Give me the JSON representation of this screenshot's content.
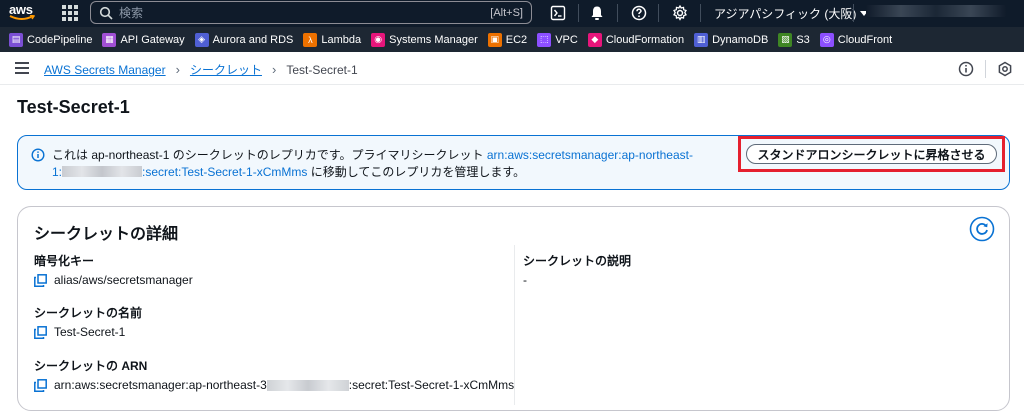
{
  "topnav": {
    "logo_text": "aws",
    "search_placeholder": "検索",
    "search_shortcut": "[Alt+S]",
    "region": "アジアパシフィック (大阪)",
    "account": ""
  },
  "favorites": [
    {
      "label": "CodePipeline",
      "color": "#7b4fd4",
      "icon": "codepipeline-icon"
    },
    {
      "label": "API Gateway",
      "color": "#a14fd4",
      "icon": "api-gateway-icon"
    },
    {
      "label": "Aurora and RDS",
      "color": "#4f5fd4",
      "icon": "rds-icon"
    },
    {
      "label": "Lambda",
      "color": "#ed7100",
      "icon": "lambda-icon"
    },
    {
      "label": "Systems Manager",
      "color": "#e7157b",
      "icon": "systems-manager-icon"
    },
    {
      "label": "EC2",
      "color": "#ed7100",
      "icon": "ec2-icon"
    },
    {
      "label": "VPC",
      "color": "#8c4fff",
      "icon": "vpc-icon"
    },
    {
      "label": "CloudFormation",
      "color": "#e7157b",
      "icon": "cloudformation-icon"
    },
    {
      "label": "DynamoDB",
      "color": "#4f5fd4",
      "icon": "dynamodb-icon"
    },
    {
      "label": "S3",
      "color": "#3f8624",
      "icon": "s3-icon"
    },
    {
      "label": "CloudFront",
      "color": "#8c4fff",
      "icon": "cloudfront-icon"
    }
  ],
  "breadcrumb": {
    "items": [
      "AWS Secrets Manager",
      "シークレット"
    ],
    "current": "Test-Secret-1"
  },
  "page": {
    "title": "Test-Secret-1"
  },
  "banner": {
    "text_before": "これは ap-northeast-1 のシークレットのレプリカです。プライマリシークレット ",
    "arn_part1": "arn:aws:secretsmanager:ap-northeast-",
    "arn_part2a": "1:",
    "arn_part2b": ":secret:Test-Secret-1-xCmMms",
    "text_after": " に移動してこのレプリカを管理します。",
    "button": "スタンドアロンシークレットに昇格させる"
  },
  "details": {
    "title": "シークレットの詳細",
    "encryption_key_label": "暗号化キー",
    "encryption_key_value": "alias/aws/secretsmanager",
    "secret_name_label": "シークレットの名前",
    "secret_name_value": "Test-Secret-1",
    "secret_arn_label": "シークレットの ARN",
    "secret_arn_prefix": "arn:aws:secretsmanager:ap-northeast-3",
    "secret_arn_suffix": ":secret:Test-Secret-1-xCmMms",
    "description_label": "シークレットの説明",
    "description_value": "-"
  },
  "colors": {
    "nav_bg": "#0f1b2a",
    "link": "#0972d3",
    "banner_bg": "#f2f8fd",
    "highlight": "#e5202e"
  }
}
